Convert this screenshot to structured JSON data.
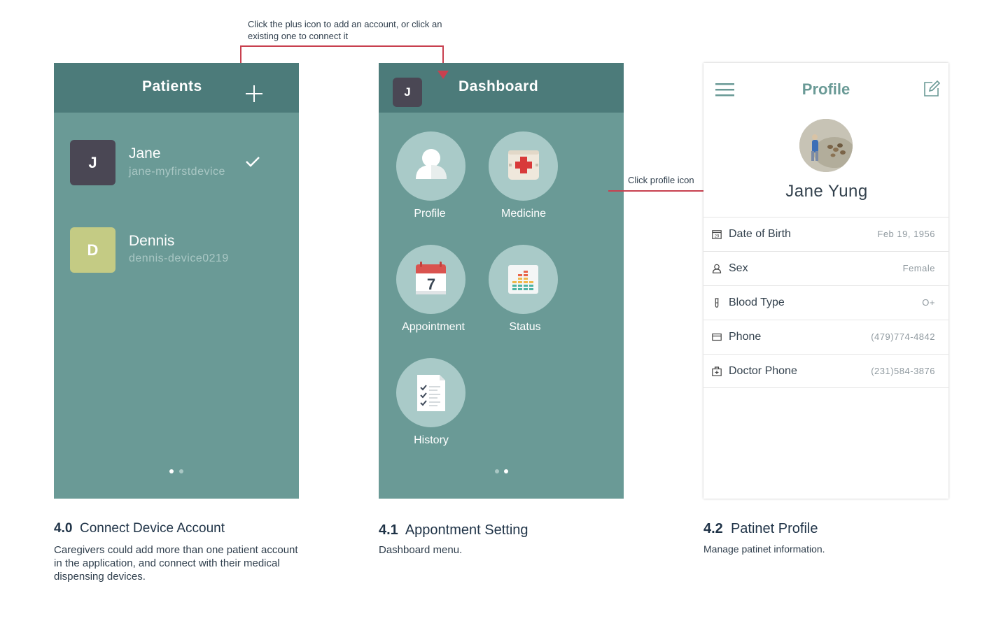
{
  "annotations": {
    "plus_hint": "Click the plus icon to add an account, or click an existing one to connect it",
    "profile_hint": "Click profile icon"
  },
  "screen1": {
    "title": "Patients",
    "patients": [
      {
        "initial": "J",
        "name": "Jane",
        "device": "jane-myfirstdevice",
        "selected": true
      },
      {
        "initial": "D",
        "name": "Dennis",
        "device": "dennis-device0219",
        "selected": false
      }
    ]
  },
  "screen2": {
    "avatar_initial": "J",
    "title": "Dashboard",
    "menu": [
      {
        "label": "Profile",
        "icon": "person-icon"
      },
      {
        "label": "Medicine",
        "icon": "first-aid-kit-icon"
      },
      {
        "label": "Appointment",
        "icon": "calendar-icon",
        "calendar_day": "7"
      },
      {
        "label": "Status",
        "icon": "bar-chart-icon"
      },
      {
        "label": "History",
        "icon": "checklist-icon"
      }
    ]
  },
  "screen3": {
    "title": "Profile",
    "name": "Jane Yung",
    "fields": [
      {
        "label": "Date of Birth",
        "value": "Feb 19, 1956",
        "icon": "calendar-icon",
        "icon_text": "29"
      },
      {
        "label": "Sex",
        "value": "Female",
        "icon": "person-icon"
      },
      {
        "label": "Blood Type",
        "value": "O+",
        "icon": "test-tube-icon"
      },
      {
        "label": "Phone",
        "value": "(479)774-4842",
        "icon": "card-icon"
      },
      {
        "label": "Doctor Phone",
        "value": "(231)584-3876",
        "icon": "medical-bag-icon"
      }
    ]
  },
  "captions": [
    {
      "num": "4.0",
      "title": "Connect Device Account",
      "body": "Caregivers could add more than one patient account in the application, and connect with their medical dispensing devices."
    },
    {
      "num": "4.1",
      "title": "Appontment Setting",
      "body": "Dashboard menu."
    },
    {
      "num": "4.2",
      "title": "Patinet Profile",
      "body": "Manage patinet information."
    }
  ],
  "colors": {
    "header": "#4c7b7a",
    "body": "#6a9a96",
    "accent_red": "#c8404f",
    "circle": "#a9cac8",
    "profile_accent": "#6a9a96"
  }
}
